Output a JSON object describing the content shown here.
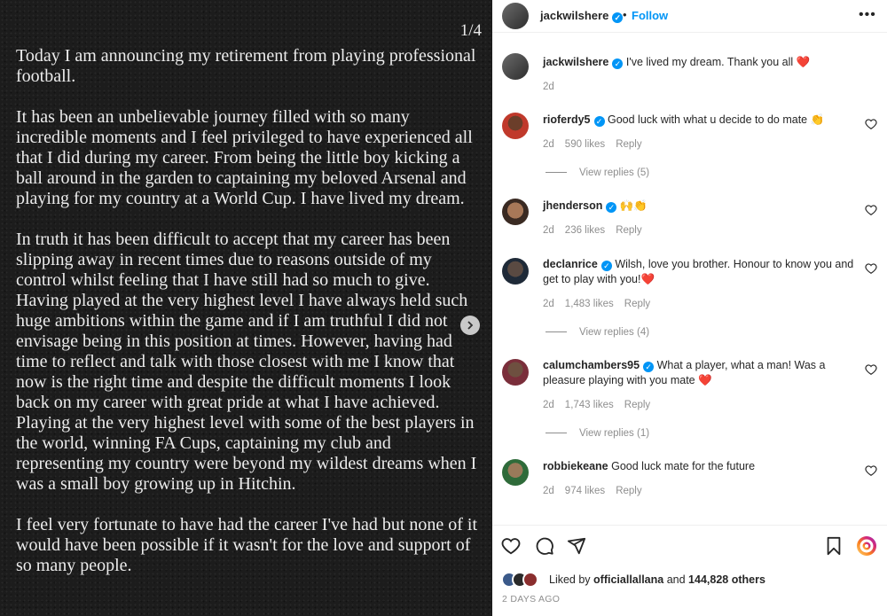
{
  "post_image": {
    "counter": "1/4",
    "paragraphs": [
      "Today I am announcing my retirement from playing professional football.",
      "It has been an unbelievable journey filled with so many incredible moments and I feel privileged to have experienced all that I did during my career. From being the little boy kicking a ball around in the garden to captaining my beloved Arsenal and playing for my country at a World Cup. I have lived my dream.",
      "In truth it has been difficult to accept that my career has been slipping away in recent times due to reasons outside of my control whilst feeling that I have still had so much to give. Having played at the very highest level I have always held such huge ambitions within the game and if I am truthful I did not envisage being in this position at times. However, having had time to reflect and talk with those closest with me I know that now is the right time and despite the difficult moments I look back on my career with great pride at what I have achieved. Playing at the very highest level with some of the best players in the world, winning FA Cups, captaining my club and representing my country were beyond my wildest dreams when I was a small boy growing up in Hitchin.",
      "I feel very fortunate to have had the career I've had but none of it would have been possible if it wasn't for the love and support of so many people."
    ]
  },
  "header": {
    "username": "jackwilshere",
    "dot": "•",
    "follow_label": "Follow",
    "more": "•••"
  },
  "caption": {
    "username": "jackwilshere",
    "text": "I've lived my dream. Thank you all",
    "emoji": "❤️",
    "age": "2d"
  },
  "comments": [
    {
      "username": "rioferdy5",
      "text": "Good luck with what u decide to do mate 👏",
      "age": "2d",
      "likes": "590 likes",
      "reply": "Reply",
      "view_replies": "View replies (5)"
    },
    {
      "username": "jhenderson",
      "text": "🙌👏",
      "age": "2d",
      "likes": "236 likes",
      "reply": "Reply",
      "view_replies": ""
    },
    {
      "username": "declanrice",
      "text": "Wilsh, love you brother. Honour to know you and get to play with you!❤️",
      "age": "2d",
      "likes": "1,483 likes",
      "reply": "Reply",
      "view_replies": "View replies (4)"
    },
    {
      "username": "calumchambers95",
      "text": "What a player, what a man! Was a pleasure playing with you mate ❤️",
      "age": "2d",
      "likes": "1,743 likes",
      "reply": "Reply",
      "view_replies": "View replies (1)"
    },
    {
      "username": "robbiekeane",
      "text": "Good luck mate for the future",
      "age": "2d",
      "likes": "974 likes",
      "reply": "Reply",
      "view_replies": ""
    }
  ],
  "likes": {
    "prefix": "Liked by ",
    "user": "officiallallana",
    "middle": " and ",
    "count": "144,828 others"
  },
  "date": "2 DAYS AGO",
  "colors": {
    "accent": "#0095f6",
    "heart": "#ed4956",
    "muted": "#8e8e8e"
  }
}
